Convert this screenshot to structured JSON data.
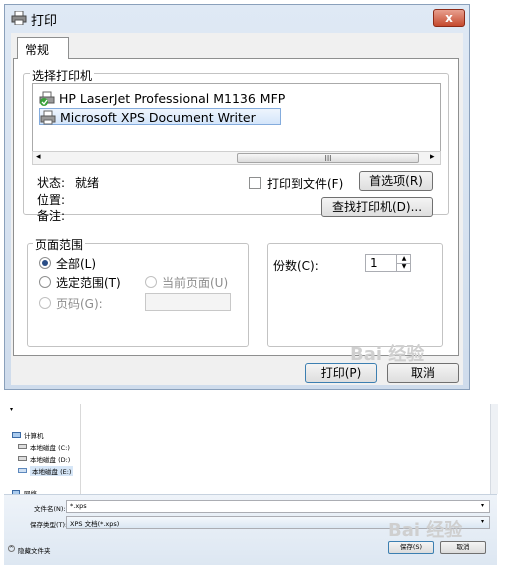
{
  "print_dialog": {
    "title": "打印",
    "close_glyph": "x",
    "tab_general": "常规",
    "select_printer_legend": "选择打印机",
    "printers": [
      {
        "name": "HP LaserJet Professional M1136 MFP",
        "selected": false
      },
      {
        "name": "Microsoft XPS Document Writer",
        "selected": true
      }
    ],
    "scroll_left": "◂",
    "scroll_right": "▸",
    "scroll_grip": "III",
    "status_label": "状态:",
    "status_value": "就绪",
    "location_label": "位置:",
    "comment_label": "备注:",
    "print_to_file_label": "打印到文件(F)",
    "preferences_button": "首选项(R)",
    "find_printer_button": "查找打印机(D)...",
    "page_range_legend": "页面范围",
    "range_all": "全部(L)",
    "range_selection": "选定范围(T)",
    "range_current": "当前页面(U)",
    "range_pages": "页码(G):",
    "copies_label": "份数(C):",
    "copies_value": "1",
    "print_button": "打印(P)",
    "cancel_button": "取消"
  },
  "save_dialog": {
    "nav_computer": "计算机",
    "nav_drives": [
      "本地磁盘 (C:)",
      "本地磁盘 (D:)",
      "本地磁盘 (E:)"
    ],
    "nav_network": "网络",
    "filename_label": "文件名(N):",
    "filename_value": "*.xps",
    "savetype_label": "保存类型(T):",
    "savetype_value": "XPS 文档(*.xps)",
    "hide_folders": "隐藏文件夹",
    "save_button": "保存(S)",
    "cancel_button": "取消"
  },
  "watermark_text": "Bai 经验",
  "colors": {
    "accent": "#2a4d86",
    "close": "#c54a2e",
    "selection": "#d4e5fa"
  }
}
